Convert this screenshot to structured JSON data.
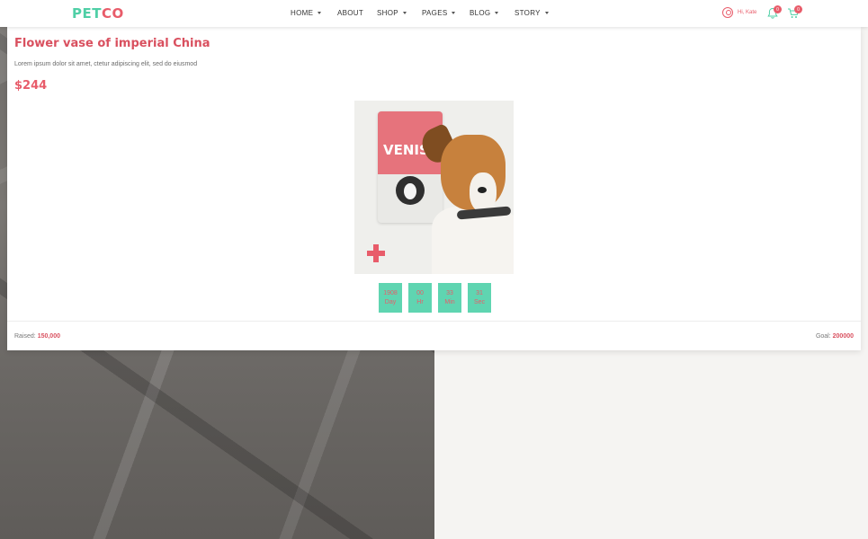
{
  "brand": {
    "logo_part1": "PET",
    "logo_part2": "CO"
  },
  "nav": [
    {
      "label": "HOME"
    },
    {
      "label": "ABOUT"
    },
    {
      "label": "SHOP"
    },
    {
      "label": "PAGES"
    },
    {
      "label": "BLOG"
    },
    {
      "label": "STORY"
    }
  ],
  "user": {
    "greeting": "Hi, Kate",
    "notifications_count": "0",
    "cart_count": "0"
  },
  "product": {
    "title": "Flower vase of imperial China",
    "description": "Lorem ipsum dolor sit amet, ctetur adipiscing elit, sed do eiusmod",
    "price": "$244",
    "image_bag_text": "VENISU"
  },
  "countdown": [
    {
      "value": "1908",
      "unit": "Day"
    },
    {
      "value": "00",
      "unit": "Hr"
    },
    {
      "value": "33",
      "unit": "Min"
    },
    {
      "value": "31",
      "unit": "Sec"
    }
  ],
  "funding": {
    "raised_label": "Raised:",
    "raised_value": "150,000",
    "goal_label": "Goal:",
    "goal_value": "200000"
  },
  "colors": {
    "brand_green": "#4fcfa6",
    "brand_red": "#e85c6a",
    "countdown_bg": "#5fd5b1"
  }
}
